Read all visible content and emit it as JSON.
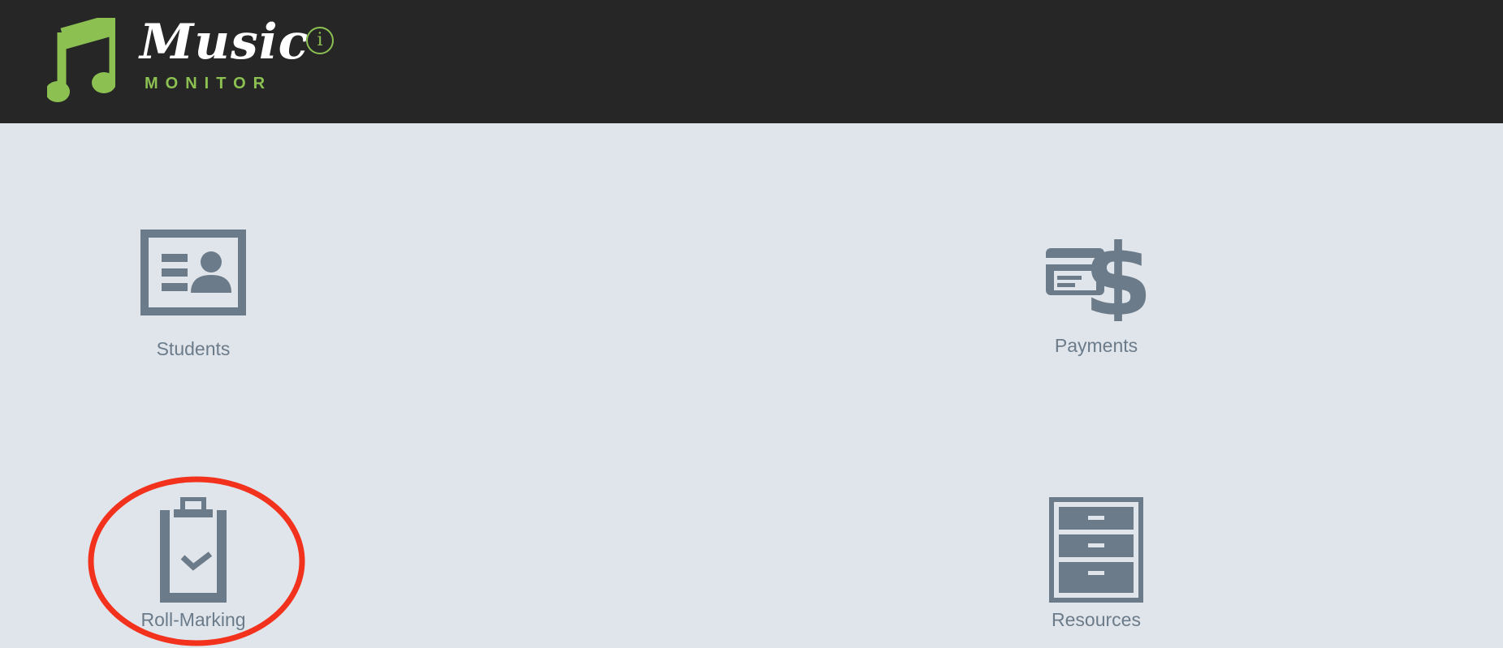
{
  "brand": {
    "name_script": "Music",
    "name_sub": "MONITOR",
    "accent_color": "#8cc152",
    "logo_icon": "music-note-icon"
  },
  "header": {
    "info_glyph": "i",
    "info_icon": "info-icon",
    "background": "#262626"
  },
  "dashboard": {
    "tiles": [
      {
        "label": "Students",
        "icon": "id-card-icon"
      },
      {
        "label": "Payments",
        "icon": "payment-dollar-icon"
      },
      {
        "label": "Roll-Marking",
        "icon": "clipboard-check-icon"
      },
      {
        "label": "Resources",
        "icon": "filing-cabinet-icon"
      }
    ],
    "icon_color": "#6b7b89",
    "background": "#e0e5ec"
  },
  "annotation": {
    "highlight_color": "#f2321c",
    "highlighted_tile": "Roll-Marking"
  }
}
